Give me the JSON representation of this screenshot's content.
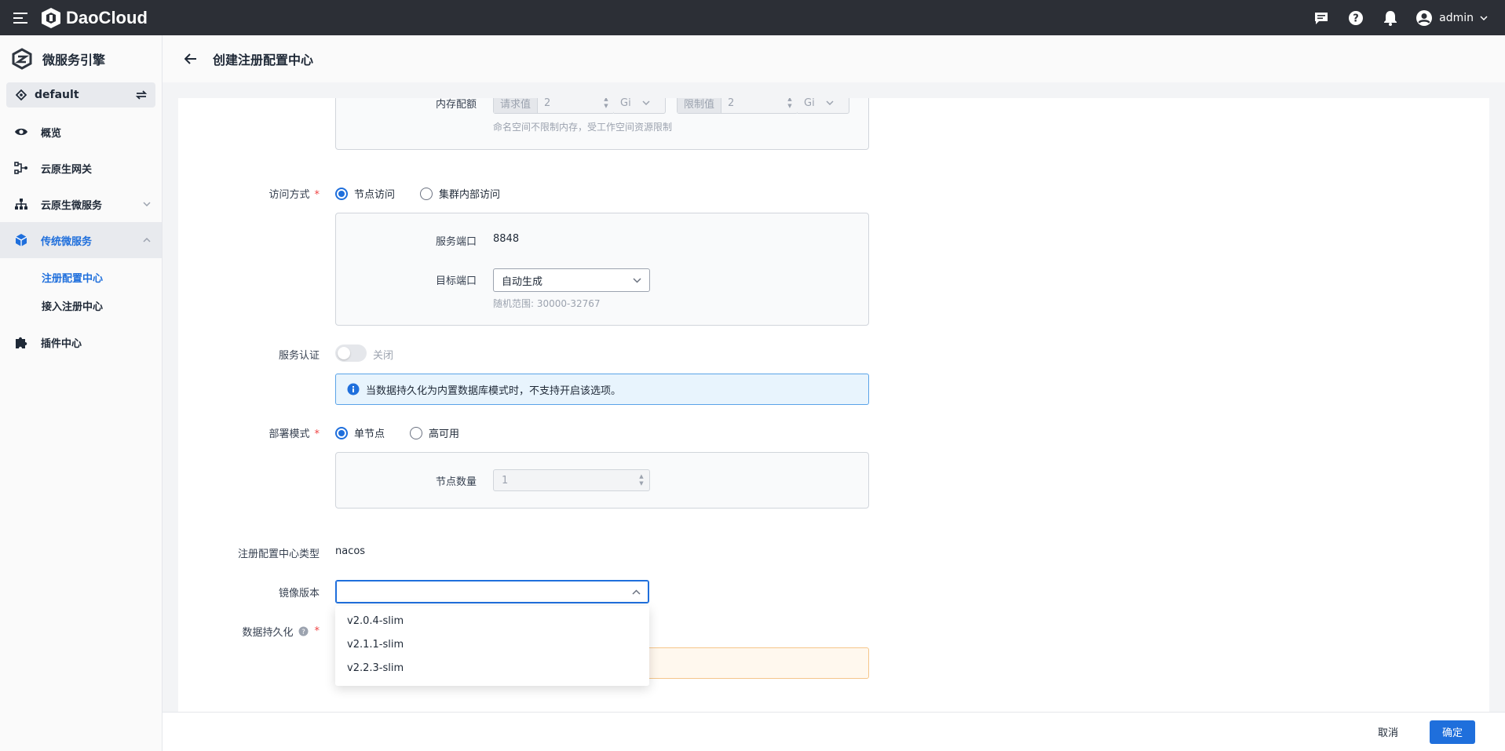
{
  "app": {
    "name": "DaoCloud",
    "user": "admin"
  },
  "sidebar": {
    "brand": "微服务引擎",
    "namespace": "default",
    "items": [
      {
        "label": "概览",
        "icon": "eye-icon"
      },
      {
        "label": "云原生网关",
        "icon": "gateway-icon"
      },
      {
        "label": "云原生微服务",
        "icon": "hierarchy-icon"
      },
      {
        "label": "传统微服务",
        "icon": "cube-icon"
      },
      {
        "label": "插件中心",
        "icon": "puzzle-icon"
      }
    ],
    "subitems": [
      {
        "label": "注册配置中心",
        "active": true
      },
      {
        "label": "接入注册中心",
        "active": false
      }
    ]
  },
  "header": {
    "title": "创建注册配置中心"
  },
  "form": {
    "memory": {
      "label": "内存配额",
      "request_label": "请求值",
      "request_value": "2",
      "request_unit": "Gi",
      "limit_label": "限制值",
      "limit_value": "2",
      "limit_unit": "Gi",
      "hint": "命名空间不限制内存，受工作空间资源限制"
    },
    "access": {
      "label": "访问方式",
      "options": [
        "节点访问",
        "集群内部访问"
      ],
      "selected": "节点访问",
      "service_port_label": "服务端口",
      "service_port_value": "8848",
      "target_port_label": "目标端口",
      "target_port_value": "自动生成",
      "target_port_hint": "随机范围: 30000-32767"
    },
    "auth": {
      "label": "服务认证",
      "toggle_text": "关闭",
      "info": "当数据持久化为内置数据库模式时，不支持开启该选项。"
    },
    "deploy": {
      "label": "部署模式",
      "options": [
        "单节点",
        "高可用"
      ],
      "selected": "单节点",
      "node_count_label": "节点数量",
      "node_count_value": "1"
    },
    "type": {
      "label": "注册配置中心类型",
      "value": "nacos"
    },
    "image": {
      "label": "镜像版本",
      "value": "",
      "options": [
        "v2.0.4-slim",
        "v2.1.1-slim",
        "v2.2.3-slim"
      ]
    },
    "persistence": {
      "label": "数据持久化"
    }
  },
  "footer": {
    "cancel": "取消",
    "confirm": "确定"
  },
  "colors": {
    "primary": "#1f6fdc",
    "topbar": "#2c2f36",
    "required": "#ef4444"
  }
}
